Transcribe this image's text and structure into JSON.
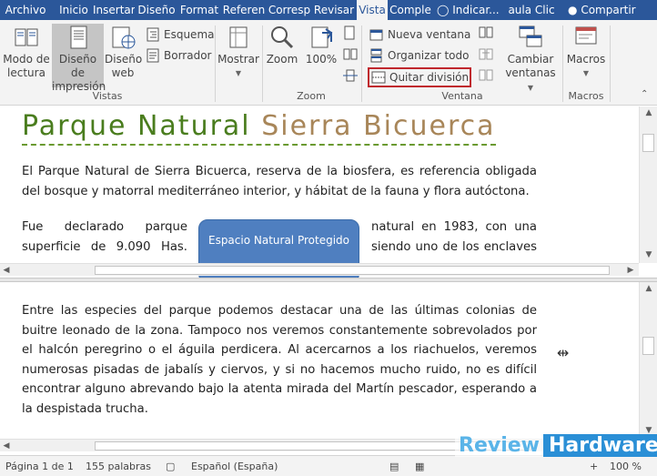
{
  "tabs": [
    "Archivo",
    "Inicio",
    "Insertar",
    "Diseño",
    "Format",
    "Referen",
    "Corresp",
    "Revisar",
    "Vista",
    "Comple",
    "Indicar...",
    "aula Clic",
    "Compartir"
  ],
  "active_tab": "Vista",
  "ribbon": {
    "vistas": {
      "modo_lectura": "Modo de lectura",
      "diseno_impresion": "Diseño de impresión",
      "diseno_web": "Diseño web",
      "esquema": "Esquema",
      "borrador": "Borrador",
      "label": "Vistas"
    },
    "mostrar": "Mostrar",
    "zoom": {
      "zoom": "Zoom",
      "cien": "100%",
      "label": "Zoom"
    },
    "ventana": {
      "nueva_ventana": "Nueva ventana",
      "organizar_todo": "Organizar todo",
      "quitar_division": "Quitar división",
      "cambiar_ventanas": "Cambiar ventanas",
      "label": "Ventana"
    },
    "macros": {
      "macros": "Macros",
      "label": "Macros"
    }
  },
  "document": {
    "title_part1": "Parque Natural ",
    "title_part2": "Sierra Bicuerca",
    "para1": "El Parque Natural de Sierra Bicuerca, reserva de la biosfera, es referencia obligada del bosque y matorral mediterráneo interior, y hábitat de la fauna y flora autóctona.",
    "para2_left_line1": "Fue declarado parque",
    "para2_left_line2": "superficie de 9.090 Has.",
    "para2_right_line1": "natural en 1983, con una",
    "para2_right_line2": "siendo uno de los enclaves",
    "shape_text": "Espacio Natural Protegido",
    "para3": "Entre las especies del parque podemos destacar una de las últimas colonias de buitre leonado de la zona. Tampoco nos veremos constantemente sobrevolados por el halcón peregrino o el águila perdicera. Al acercarnos a los riachuelos, veremos numerosas pisadas de jabalís y ciervos, y si no hacemos mucho ruido, no es difícil encontrar alguno abrevando bajo la atenta mirada del Martín pescador, esperando a la despistada trucha."
  },
  "status": {
    "page": "Página 1 de 1",
    "words": "155 palabras",
    "language": "Español (España)",
    "zoom": "100 %"
  },
  "watermark": {
    "part1": "Review",
    "part2": "Hardware"
  },
  "colors": {
    "accent": "#2b579a",
    "highlight_box": "#c0272d",
    "title_green": "#4a7d1e",
    "title_brown": "#a88659",
    "shape_fill": "#4f7fc0"
  }
}
